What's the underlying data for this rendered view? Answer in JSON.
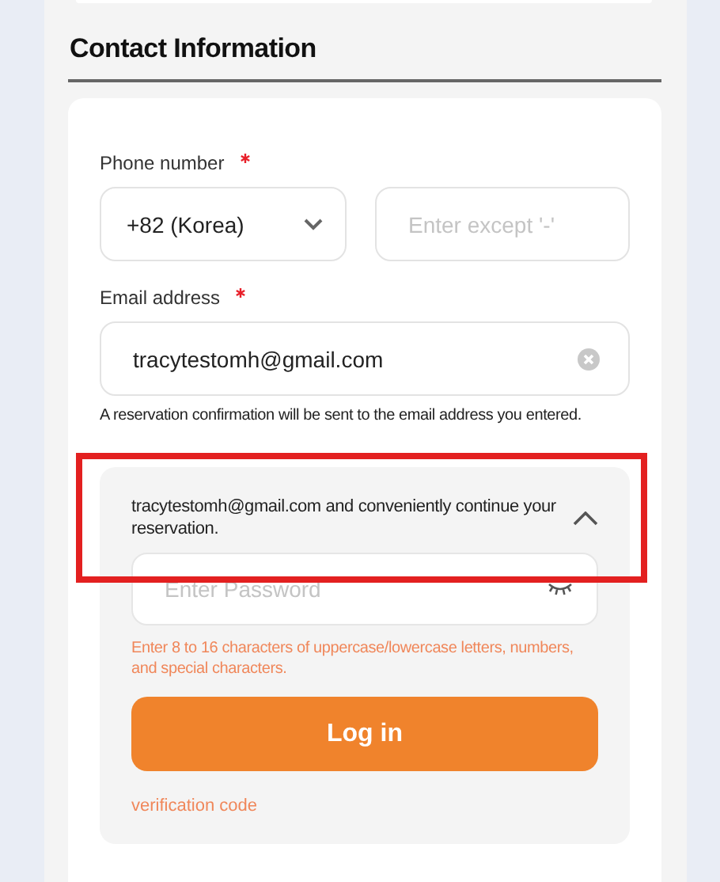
{
  "section_title": "Contact Information",
  "phone": {
    "label": "Phone number",
    "required": true,
    "country": "+82 (Korea)",
    "placeholder": "Enter except '-'"
  },
  "email": {
    "label": "Email address",
    "required": true,
    "value": "tracytestomh@gmail.com",
    "note": "A reservation confirmation will be sent to the email address you entered."
  },
  "login_panel": {
    "message": "tracytestomh@gmail.com and conveniently continue your reservation.",
    "expanded": true,
    "highlighted": true,
    "password_placeholder": "Enter Password",
    "hint": "Enter 8 to 16 characters of uppercase/lowercase letters, numbers, and special characters.",
    "button": "Log in",
    "link": "verification code"
  }
}
